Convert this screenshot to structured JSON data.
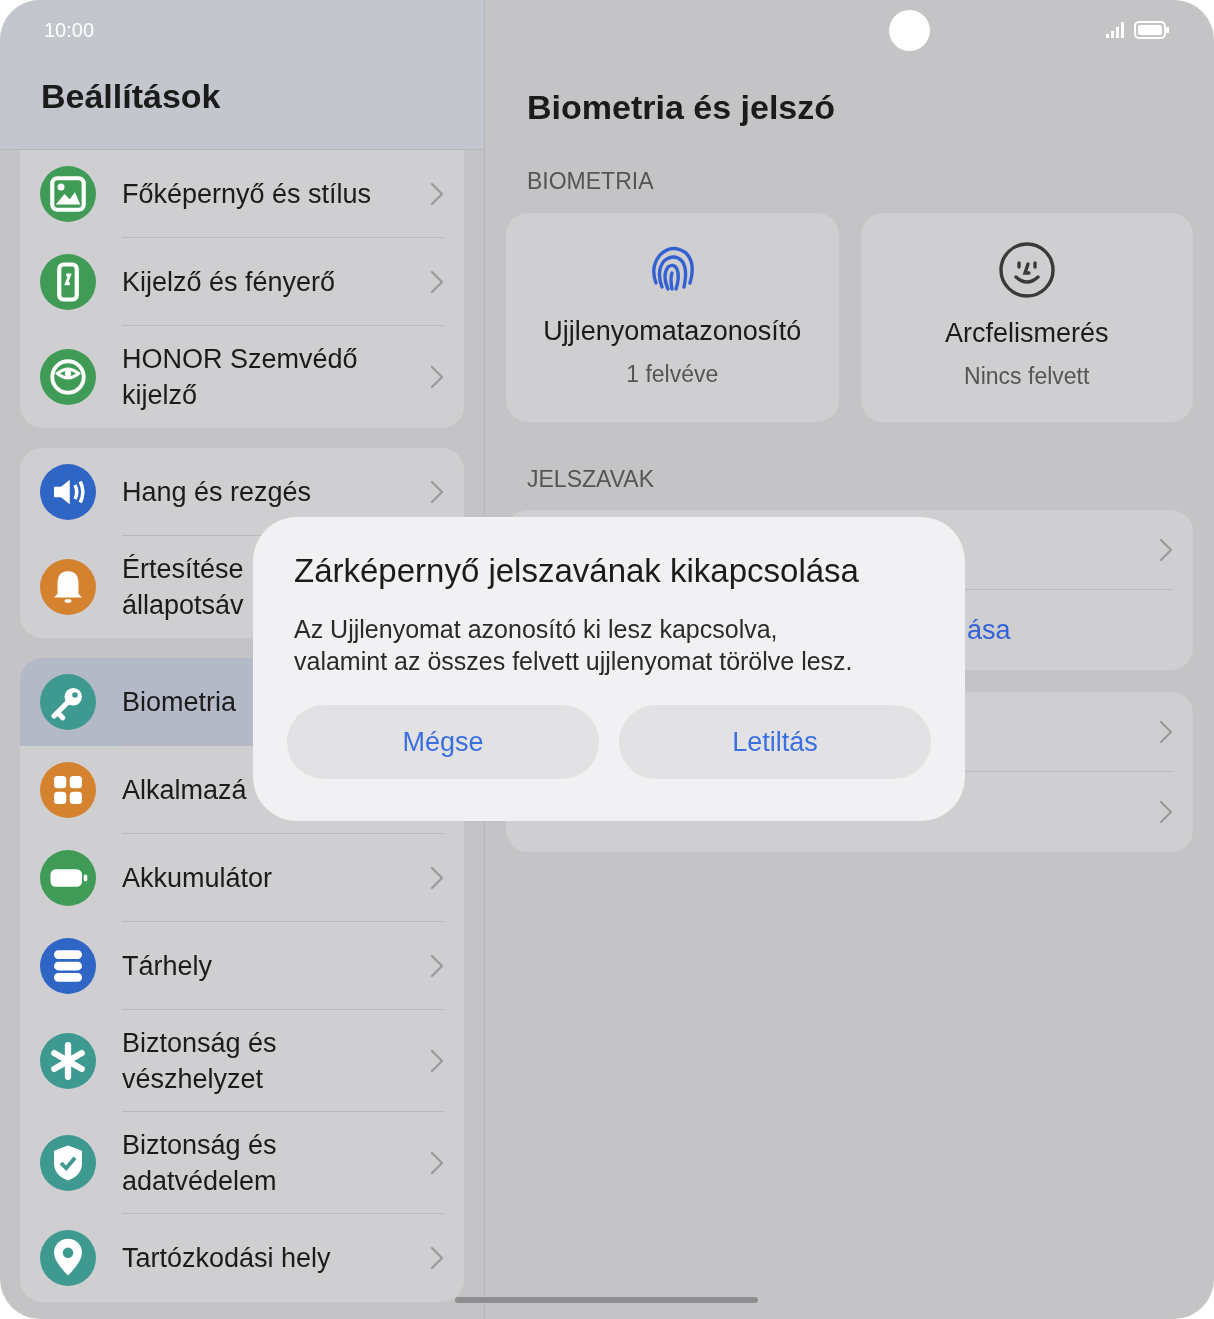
{
  "status_bar": {
    "time": "10:00"
  },
  "sidebar": {
    "title": "Beállítások",
    "groups": [
      {
        "items": [
          {
            "label": "Főképernyő és stílus",
            "kind": "image",
            "color": "#3f9b55",
            "selected": false,
            "chevron": true
          },
          {
            "label": "Kijelző és fényerő",
            "kind": "phone",
            "color": "#3f9b55",
            "selected": false,
            "chevron": true
          },
          {
            "label": "HONOR Szemvédő kijelző",
            "kind": "eye",
            "color": "#3f9b55",
            "selected": false,
            "chevron": true
          }
        ]
      },
      {
        "items": [
          {
            "label": "Hang és rezgés",
            "kind": "speaker",
            "color": "#2f65c4",
            "selected": false,
            "chevron": true
          },
          {
            "label": "Értesítése állapotsáv",
            "kind": "bell",
            "color": "#d4822e",
            "selected": false,
            "chevron": false
          }
        ]
      },
      {
        "items": [
          {
            "label": "Biometria",
            "kind": "key",
            "color": "#3e9a91",
            "selected": true,
            "chevron": false
          },
          {
            "label": "Alkalmazá",
            "kind": "grid",
            "color": "#d4822e",
            "selected": false,
            "chevron": false
          },
          {
            "label": "Akkumulátor",
            "kind": "battery",
            "color": "#3f9b55",
            "selected": false,
            "chevron": true
          },
          {
            "label": "Tárhely",
            "kind": "storage",
            "color": "#2f65c4",
            "selected": false,
            "chevron": true
          },
          {
            "label": "Biztonság és vészhelyzet",
            "kind": "asterisk",
            "color": "#3e9a91",
            "selected": false,
            "chevron": true
          },
          {
            "label": "Biztonság és adatvédelem",
            "kind": "shield",
            "color": "#3e9a91",
            "selected": false,
            "chevron": true
          },
          {
            "label": "Tartózkodási hely",
            "kind": "pin",
            "color": "#3e9a91",
            "selected": false,
            "chevron": true
          }
        ]
      }
    ]
  },
  "detail": {
    "title": "Biometria és jelszó",
    "biometrics": {
      "heading": "BIOMETRIA",
      "tiles": [
        {
          "kind": "fingerprint",
          "title": "Ujjlenyomatazonosító",
          "subtitle": "1 felvéve"
        },
        {
          "kind": "face",
          "title": "Arcfelismerés",
          "subtitle": "Nincs felvett"
        }
      ]
    },
    "passwords": {
      "heading": "JELSZAVAK",
      "cards": [
        {
          "rows": [
            {
              "chevron": true
            },
            {
              "label": "ása",
              "kind": "link",
              "chevron": false
            }
          ]
        },
        {
          "rows": [
            {
              "chevron": true
            },
            {
              "chevron": true
            }
          ]
        }
      ]
    }
  },
  "dialog": {
    "title": "Zárképernyő jelszavának kikapcsolása",
    "message": "Az Ujjlenyomat azonosító ki lesz kapcsolva,\nvalamint az összes felvett ujjlenyomat törölve lesz.",
    "buttons": [
      "Mégse",
      "Letiltás"
    ]
  }
}
